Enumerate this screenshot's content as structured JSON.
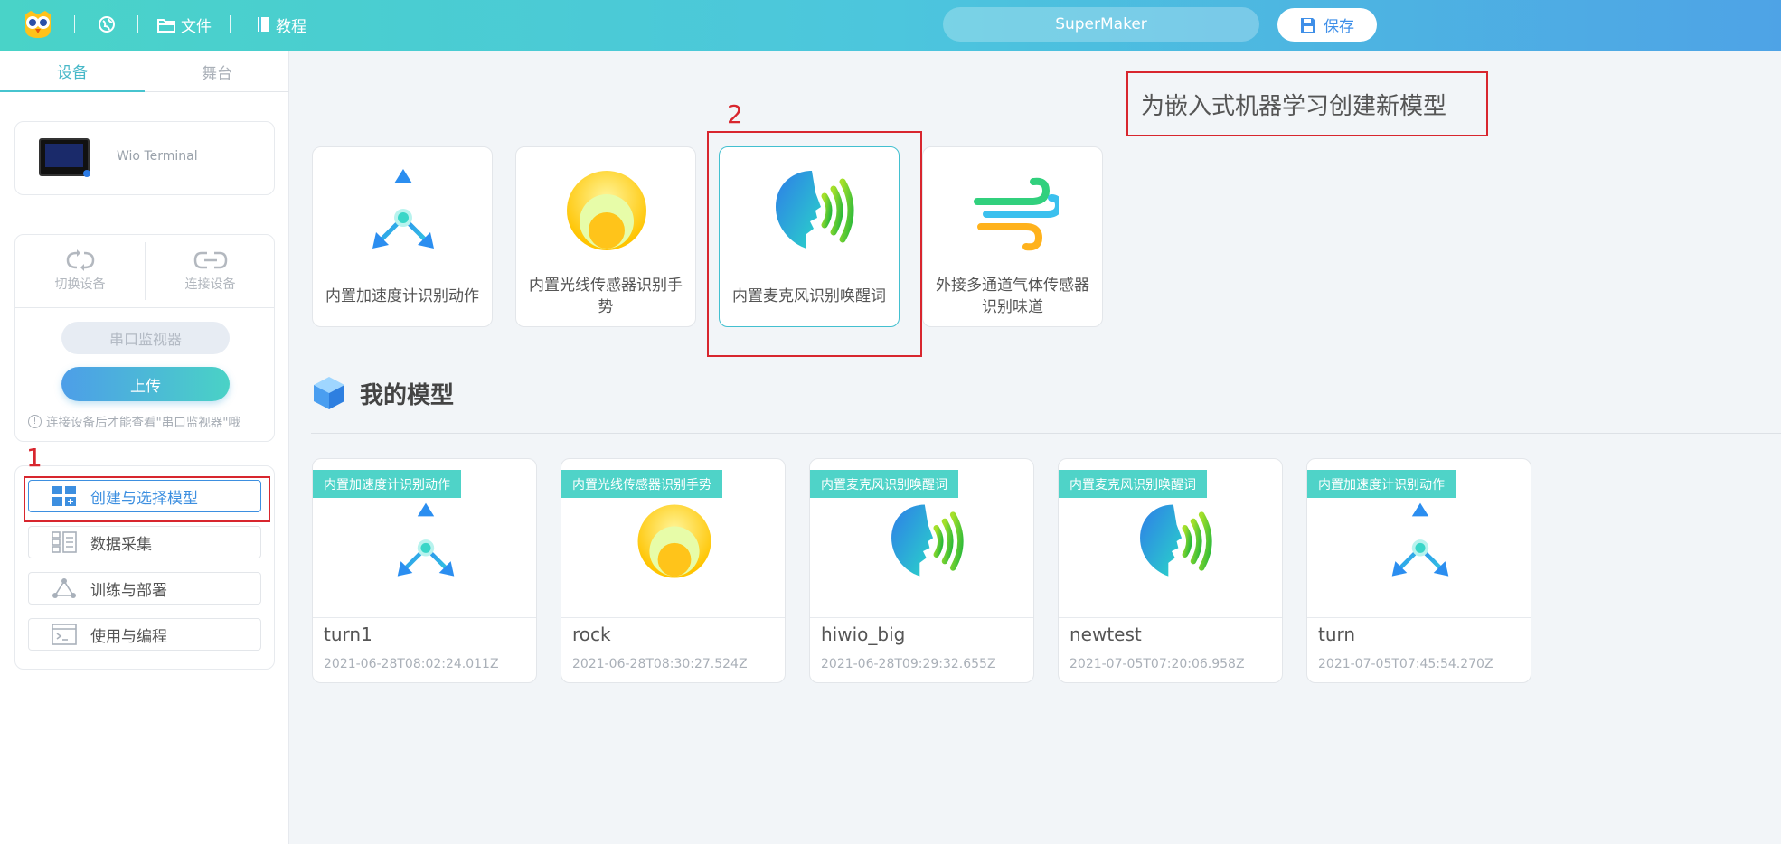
{
  "topbar": {
    "file_label": "文件",
    "tutorial_label": "教程",
    "project_name": "SuperMaker",
    "save_label": "保存"
  },
  "sidebar": {
    "tabs": [
      "设备",
      "舞台"
    ],
    "device_name": "Wio Terminal",
    "switch_device": "切换设备",
    "connect_device": "连接设备",
    "serial_monitor": "串口监视器",
    "upload": "上传",
    "hint": "连接设备后才能查看\"串口监视器\"哦",
    "menu": [
      {
        "label": "创建与选择模型",
        "icon": "create-model-icon"
      },
      {
        "label": "数据采集",
        "icon": "data-collect-icon"
      },
      {
        "label": "训练与部署",
        "icon": "train-deploy-icon"
      },
      {
        "label": "使用与编程",
        "icon": "code-icon"
      }
    ]
  },
  "annotations": {
    "n1": "1",
    "n2": "2",
    "headline": "为嵌入式机器学习创建新模型"
  },
  "model_types": [
    {
      "label": "内置加速度计识别动作",
      "icon": "accelerometer-icon"
    },
    {
      "label": "内置光线传感器识别手势",
      "icon": "light-sensor-icon"
    },
    {
      "label": "内置麦克风识别唤醒词",
      "icon": "microphone-voice-icon"
    },
    {
      "label": "外接多通道气体传感器识别味道",
      "icon": "gas-sensor-icon"
    }
  ],
  "my_models_title": "我的模型",
  "my_models": [
    {
      "tag": "内置加速度计识别动作",
      "name": "turn1",
      "date": "2021-06-28T08:02:24.011Z",
      "icon": "accelerometer-icon"
    },
    {
      "tag": "内置光线传感器识别手势",
      "name": "rock",
      "date": "2021-06-28T08:30:27.524Z",
      "icon": "light-sensor-icon"
    },
    {
      "tag": "内置麦克风识别唤醒词",
      "name": "hiwio_big",
      "date": "2021-06-28T09:29:32.655Z",
      "icon": "microphone-voice-icon"
    },
    {
      "tag": "内置麦克风识别唤醒词",
      "name": "newtest",
      "date": "2021-07-05T07:20:06.958Z",
      "icon": "microphone-voice-icon"
    },
    {
      "tag": "内置加速度计识别动作",
      "name": "turn",
      "date": "2021-07-05T07:45:54.270Z",
      "icon": "accelerometer-icon"
    }
  ],
  "colors": {
    "accent": "#4ad2c6",
    "primary": "#3d8fe0",
    "annotation": "#d8262e"
  }
}
